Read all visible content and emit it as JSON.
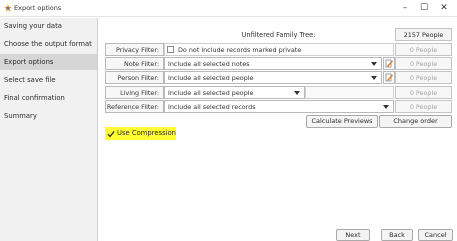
{
  "window": {
    "title": "Export options",
    "minimize_glyph": "–",
    "maximize_glyph": "☐",
    "close_glyph": "✕"
  },
  "sidebar": {
    "items": [
      {
        "label": "Saving your data",
        "selected": false
      },
      {
        "label": "Choose the output format",
        "selected": false
      },
      {
        "label": "Export options",
        "selected": true
      },
      {
        "label": "Select save file",
        "selected": false
      },
      {
        "label": "Final confirmation",
        "selected": false
      },
      {
        "label": "Summary",
        "selected": false
      }
    ]
  },
  "main": {
    "tree_header": "Unfiltered Family Tree:",
    "total_count": "2157 People",
    "privacy": {
      "label": "Privacy Filter:",
      "checkbox_label": "Do not include records marked private",
      "checked": false,
      "count": "0 People"
    },
    "note": {
      "label": "Note Filter:",
      "value": "Include all selected notes",
      "count": "0 People"
    },
    "person": {
      "label": "Person Filter:",
      "value": "Include all selected people",
      "count": "0 People"
    },
    "living": {
      "label": "Living Filter:",
      "value": "Include all selected people",
      "count": "0 People"
    },
    "reference": {
      "label": "Reference Filter:",
      "value": "Include all selected records",
      "count": "0 People"
    },
    "calculate_button": "Calculate Previews",
    "change_order_button": "Change order",
    "use_compression": {
      "label": "Use Compression",
      "checked": true,
      "highlight_color": "#ffff33"
    }
  },
  "footer": {
    "next_button": "Next",
    "back_button": "Back",
    "cancel_button": "Cancel"
  }
}
